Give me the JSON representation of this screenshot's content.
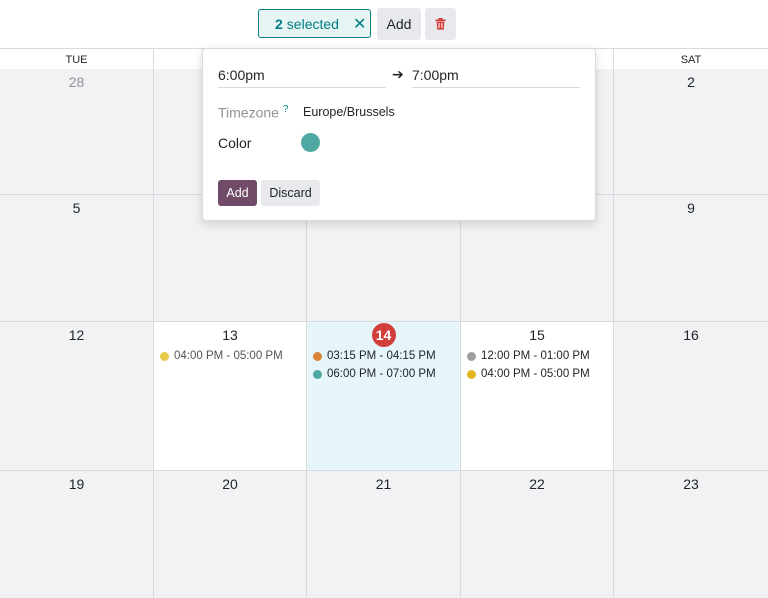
{
  "toolbar": {
    "selected_count": "2",
    "selected_label": "selected",
    "add_label": "Add"
  },
  "calendar": {
    "headers": [
      "TUE",
      "SAT"
    ],
    "weeks": [
      [
        "28",
        "",
        "",
        "",
        "2"
      ],
      [
        "5",
        "",
        "",
        "",
        "9"
      ],
      [
        "12",
        "13",
        "14",
        "15",
        "16"
      ],
      [
        "19",
        "20",
        "21",
        "22",
        "23"
      ]
    ],
    "events": {
      "day13": [
        {
          "time": "04:00 PM - 05:00 PM",
          "color": "#e6c84a"
        }
      ],
      "day14": [
        {
          "time": "03:15 PM - 04:15 PM",
          "color": "#d9843b"
        },
        {
          "time": "06:00 PM - 07:00 PM",
          "color": "#4ea9a2"
        }
      ],
      "day15": [
        {
          "time": "12:00 PM - 01:00 PM",
          "color": "#9e9e9e"
        },
        {
          "time": "04:00 PM - 05:00 PM",
          "color": "#e3b51f"
        }
      ]
    }
  },
  "popover": {
    "start_time": "6:00pm",
    "end_time": "7:00pm",
    "timezone_label": "Timezone",
    "timezone_help": "?",
    "timezone_value": "Europe/Brussels",
    "color_label": "Color",
    "color_value": "#4ea9a2",
    "add_label": "Add",
    "discard_label": "Discard"
  },
  "colors": {
    "accent": "#017e84",
    "primary": "#714b67",
    "today": "#d23f3a",
    "danger": "#d23f3a"
  }
}
